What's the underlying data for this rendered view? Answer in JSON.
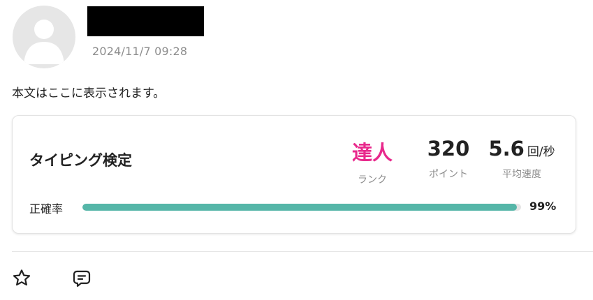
{
  "post": {
    "timestamp": "2024/11/7 09:28",
    "avatar_icon": "default-user-avatar",
    "body_text": "本文はここに表示されます。"
  },
  "result_card": {
    "title": "タイピング検定",
    "stats": {
      "rank": {
        "value": "達人",
        "label": "ランク",
        "color": "#e8298c"
      },
      "points": {
        "value": "320",
        "label": "ポイント"
      },
      "speed": {
        "value": "5.6",
        "unit": "回/秒",
        "label": "平均速度"
      }
    },
    "accuracy": {
      "label": "正確率",
      "value_text": "99%",
      "fraction": 0.99,
      "bar_color": "#55b6a8"
    }
  },
  "actions": {
    "like_icon": "star-outline-icon",
    "comment_icon": "comment-icon"
  }
}
